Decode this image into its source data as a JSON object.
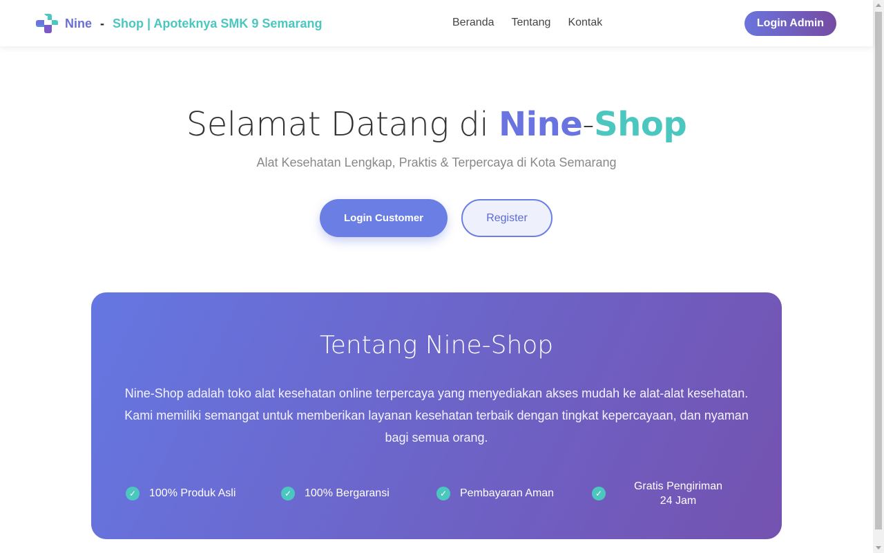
{
  "navbar": {
    "brand_nine": "Nine",
    "brand_dash": "-",
    "brand_shop": "Shop | Apoteknya SMK 9 Semarang",
    "links": [
      "Beranda",
      "Tentang",
      "Kontak"
    ],
    "admin_button": "Login Admin"
  },
  "hero": {
    "title_prefix": "Selamat Datang di ",
    "title_nine": "Nine",
    "title_dash": "-",
    "title_shop": "Shop",
    "subtitle": "Alat Kesehatan Lengkap, Praktis & Terpercaya di Kota Semarang",
    "customer_button": "Login Customer",
    "register_button": "Register"
  },
  "about": {
    "title": "Tentang Nine-Shop",
    "description": "Nine-Shop adalah toko alat kesehatan online terpercaya yang menyediakan akses mudah ke alat-alat kesehatan. Kami memiliki semangat untuk memberikan layanan kesehatan terbaik dengan tingkat kepercayaan, dan nyaman bagi semua orang.",
    "features": [
      "100% Produk Asli",
      "100% Bergaransi",
      "Pembayaran Aman",
      "Gratis Pengiriman 24 Jam"
    ]
  },
  "colors": {
    "primary": "#6a74dd",
    "accent": "#4bc7bf",
    "purple": "#764ba2"
  },
  "icons": {
    "logo": "cross-logo-icon",
    "check": "check-icon"
  }
}
